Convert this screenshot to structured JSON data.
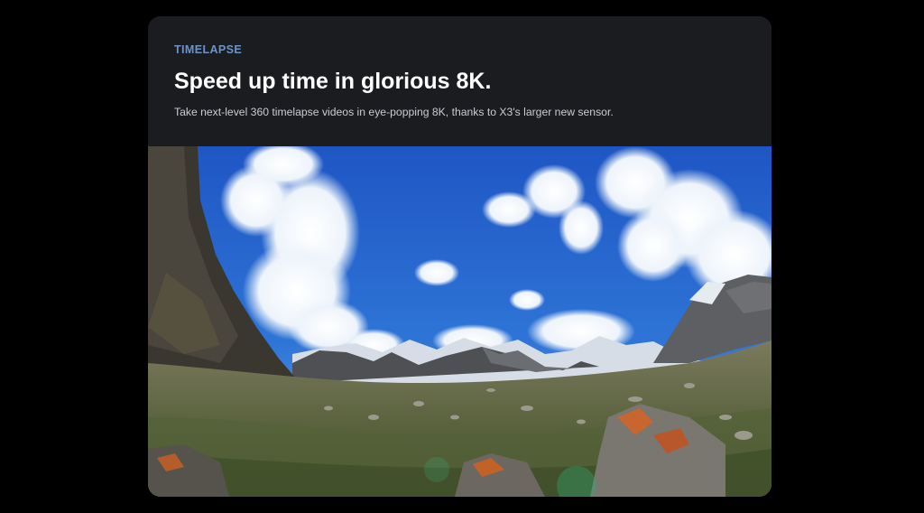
{
  "feature": {
    "eyebrow": "TIMELAPSE",
    "headline": "Speed up time in glorious 8K.",
    "description": "Take next-level 360 timelapse videos in eye-popping 8K, thanks to X3's larger new sensor."
  },
  "colors": {
    "page_background": "#000000",
    "card_background": "#1b1c1f",
    "accent": "#6c93c9",
    "headline": "#ffffff",
    "body_text": "#c9ccd2"
  },
  "media": {
    "icon": "landscape-image",
    "scene": "360-degree mountain valley timelapse under blue sky with clouds"
  }
}
